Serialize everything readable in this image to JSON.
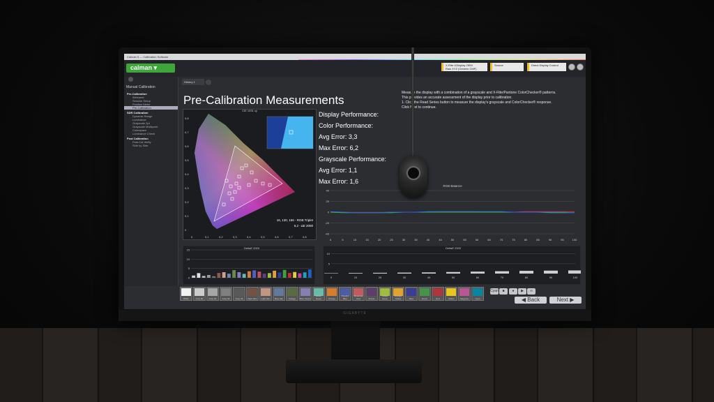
{
  "window": {
    "title": "Calman 5 — Calibration Software"
  },
  "topbar": {
    "logo": "calman",
    "meter": "X-Rite i1Display OEM",
    "meter_sub": "Raw XYZ (Generic CMF)",
    "source": "Source",
    "display": "Direct Display Control"
  },
  "sidebar": {
    "title": "Manual Calibration",
    "sections": [
      {
        "label": "Pre-Calibration",
        "items": [
          "Welcome",
          "Session Setup",
          "Position Meter",
          "Pre-Calibration"
        ]
      },
      {
        "label": "SDR Calibration",
        "items": [
          "Dynamic Range",
          "Luminance",
          "Grayscale 2pt",
          "Grayscale Multipoint",
          "Colorspace",
          "Luminance Check"
        ]
      },
      {
        "label": "Post Calibration",
        "items": [
          "Post-Cal Verify",
          "Side by Side"
        ]
      }
    ],
    "active_item": "Pre-Calibration"
  },
  "tab": {
    "label": "History 1"
  },
  "main": {
    "title": "Pre-Calibration Measurements",
    "description_lines": [
      "Measure the display with a combination of a grayscale and X-Rite/Pantone ColorChecker® patterns.",
      "This provides an accurate assessment of the display prior to calibration.",
      "1. Click the Read Series button to measure the display's grayscale and ColorChecker® response.",
      "Click Next to continue."
    ]
  },
  "performance": {
    "display_label": "Display Performance:",
    "color_label": "Color Performance:",
    "color_avg": "Avg Error: 3,3",
    "color_max": "Max Error: 6,2",
    "grayscale_label": "Grayscale Performance:",
    "gray_avg": "Avg Error: 1,1",
    "gray_max": "Max Error: 1,6"
  },
  "cie_chart": {
    "title": "CIE 1931 xy",
    "rgb_triplet": "16, 130, 156 - RGB Triplet",
    "de_label": "6,2 - ΔE 2000",
    "y_ticks": [
      "0,8",
      "0,7",
      "0,6",
      "0,5",
      "0,4",
      "0,3",
      "0,2",
      "0,1",
      "0"
    ],
    "x_ticks": [
      "0",
      "0,1",
      "0,2",
      "0,3",
      "0,4",
      "0,5",
      "0,6",
      "0,7",
      "0,8"
    ]
  },
  "chart_data": [
    {
      "type": "line",
      "title": "RGB Balance",
      "x": [
        0,
        5,
        10,
        15,
        20,
        25,
        30,
        35,
        40,
        45,
        50,
        55,
        60,
        65,
        70,
        75,
        80,
        85,
        90,
        95,
        100
      ],
      "ylim": [
        -40,
        40
      ],
      "y_ticks": [
        "40",
        "20",
        "0",
        "-20",
        "-40"
      ],
      "series": [
        {
          "color": "#e03030",
          "values": [
            0,
            0,
            -1,
            -1,
            -1,
            0,
            0,
            0,
            0,
            1,
            1,
            1,
            1,
            0,
            0,
            0,
            1,
            1,
            1,
            1,
            1
          ]
        },
        {
          "color": "#30c030",
          "values": [
            0,
            -1,
            -1,
            -1,
            -1,
            -1,
            0,
            0,
            0,
            0,
            0,
            0,
            0,
            0,
            0,
            0,
            0,
            0,
            -1,
            -1,
            -1
          ]
        },
        {
          "color": "#3060ff",
          "values": [
            1,
            0,
            -1,
            -1,
            -1,
            0,
            0,
            0,
            1,
            1,
            1,
            1,
            1,
            1,
            1,
            0,
            0,
            0,
            0,
            0,
            -1
          ]
        }
      ]
    },
    {
      "type": "bar",
      "title": "DeltaE 2000",
      "ylim": [
        0,
        15
      ],
      "y_ticks": [
        "15",
        "10",
        "5",
        "0"
      ],
      "values": [
        1.2,
        2.5,
        1.0,
        1.5,
        0.8,
        2.6,
        3.0,
        2.2,
        4.1,
        3.0,
        2.1,
        3.5,
        4.0,
        3.3,
        2.2,
        2.5,
        3.8,
        2.8,
        4.2,
        2.6,
        3.1,
        2.4,
        2.9,
        4.5
      ],
      "colors": [
        "#cfcfcf",
        "#e0e0e0",
        "#bbbbbb",
        "#999999",
        "#777777",
        "#8a5a4a",
        "#d2a08a",
        "#6b88b0",
        "#6a8a4a",
        "#8080c0",
        "#60c0b0",
        "#d08040",
        "#5060c0",
        "#c05060",
        "#604080",
        "#a0c040",
        "#e0a040",
        "#3040a0",
        "#40a040",
        "#c03030",
        "#e0d040",
        "#c040a0",
        "#20a0c0",
        "#2060c0"
      ]
    },
    {
      "type": "bar",
      "title": "DeltaE 2000",
      "x_ticks": [
        "0",
        "10",
        "20",
        "30",
        "40",
        "50",
        "60",
        "70",
        "80",
        "90",
        "100"
      ],
      "y_ticks": [
        "10",
        "5"
      ],
      "ylim": [
        0,
        12
      ],
      "values": [
        0.2,
        0.3,
        0.4,
        0.5,
        0.6,
        0.8,
        1.0,
        1.2,
        1.4,
        1.5,
        1.6
      ]
    }
  ],
  "swatches": [
    {
      "label": "White",
      "color": "#f2f2f2"
    },
    {
      "label": "Gray 80",
      "color": "#cccccc"
    },
    {
      "label": "Gray 65",
      "color": "#a6a6a6"
    },
    {
      "label": "Gray 50",
      "color": "#808080"
    },
    {
      "label": "Gray 35",
      "color": "#595959"
    },
    {
      "label": "Dark Skin",
      "color": "#735244"
    },
    {
      "label": "Light Skin",
      "color": "#c29682"
    },
    {
      "label": "Blue Sky",
      "color": "#627a9d"
    },
    {
      "label": "Foliage",
      "color": "#576c43"
    },
    {
      "label": "Blue Flower",
      "color": "#8580b1"
    },
    {
      "label": "Bluish Green",
      "color": "#67bdaa"
    },
    {
      "label": "Orange",
      "color": "#d67e2c"
    },
    {
      "label": "Purplish Blue",
      "color": "#505ba6"
    },
    {
      "label": "Moderate Red",
      "color": "#c15a63"
    },
    {
      "label": "Purple",
      "color": "#5e3c6c"
    },
    {
      "label": "Yellow Green",
      "color": "#9dbc40"
    },
    {
      "label": "Orange Yellow",
      "color": "#e0a32e"
    },
    {
      "label": "Blue",
      "color": "#383d96"
    },
    {
      "label": "Green",
      "color": "#469449"
    },
    {
      "label": "Red",
      "color": "#af363c"
    },
    {
      "label": "Yellow",
      "color": "#e7c71f"
    },
    {
      "label": "Magenta",
      "color": "#bb5695"
    },
    {
      "label": "Cyan",
      "color": "#0885a1"
    }
  ],
  "nav": {
    "back": "Back",
    "next": "Next"
  },
  "monitor_brand": "GIGABYTE"
}
